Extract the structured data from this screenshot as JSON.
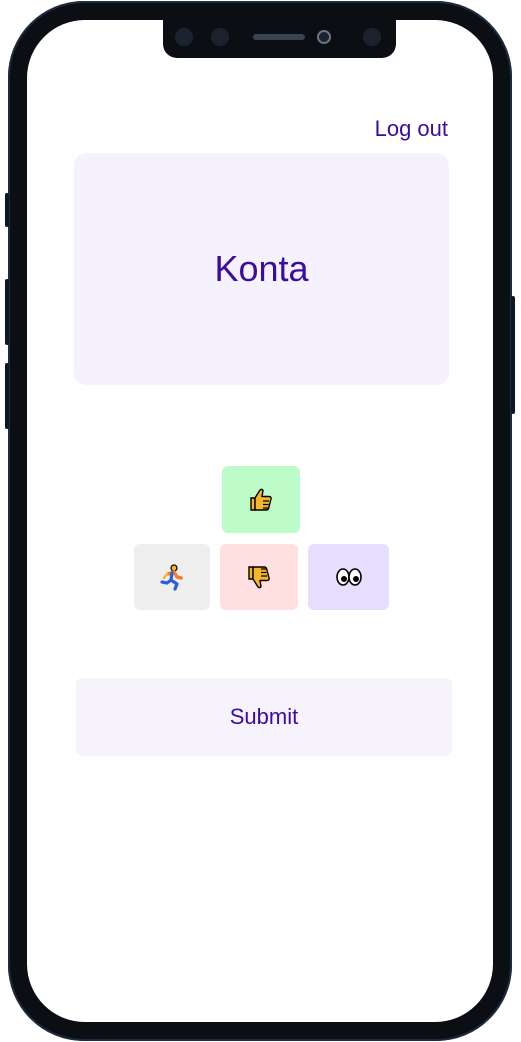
{
  "header": {
    "logout_label": "Log out"
  },
  "card": {
    "title": "Konta"
  },
  "reactions": [
    {
      "name": "thumbs-up",
      "color": "#bdfcc9"
    },
    {
      "name": "running",
      "color": "#eeeeee"
    },
    {
      "name": "thumbs-down",
      "color": "#ffdfe0"
    },
    {
      "name": "eyes",
      "color": "#e6ddff"
    }
  ],
  "footer": {
    "submit_label": "Submit"
  },
  "colors": {
    "accent": "#3a0ca3",
    "card_bg": "#f5f2fd"
  }
}
